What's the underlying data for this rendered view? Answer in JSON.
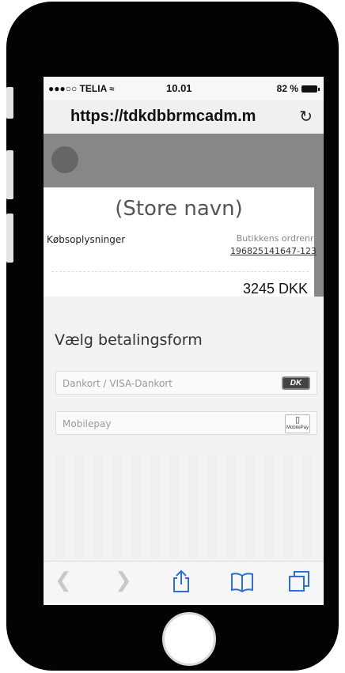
{
  "status_bar": {
    "carrier": "●●●○○ TELIA",
    "time": "10.01",
    "battery": "82 %"
  },
  "browser": {
    "url": "https://tdkdbbrmcadm.m",
    "reload_icon": "reload-icon"
  },
  "order": {
    "store_name": "(Store navn)",
    "purchase_info_label": "Købsoplysninger",
    "order_number_label": "Butikkens ordrenr:",
    "order_number": "196825141647-123",
    "amount": "3245 DKK"
  },
  "payment": {
    "title": "Vælg betalingsform",
    "options": [
      {
        "label": "Dankort / VISA-Dankort",
        "icon": "dankort-icon",
        "icon_text": "DK"
      },
      {
        "label": "Mobilepay",
        "icon": "mobilepay-icon",
        "icon_text": "MobilePay"
      }
    ]
  },
  "toolbar": {
    "items": [
      "back-icon",
      "forward-icon",
      "share-icon",
      "bookmarks-icon",
      "tabs-icon"
    ]
  },
  "colors": {
    "toolbar_accent": "#2a6fdb",
    "header_gray": "#878787"
  }
}
